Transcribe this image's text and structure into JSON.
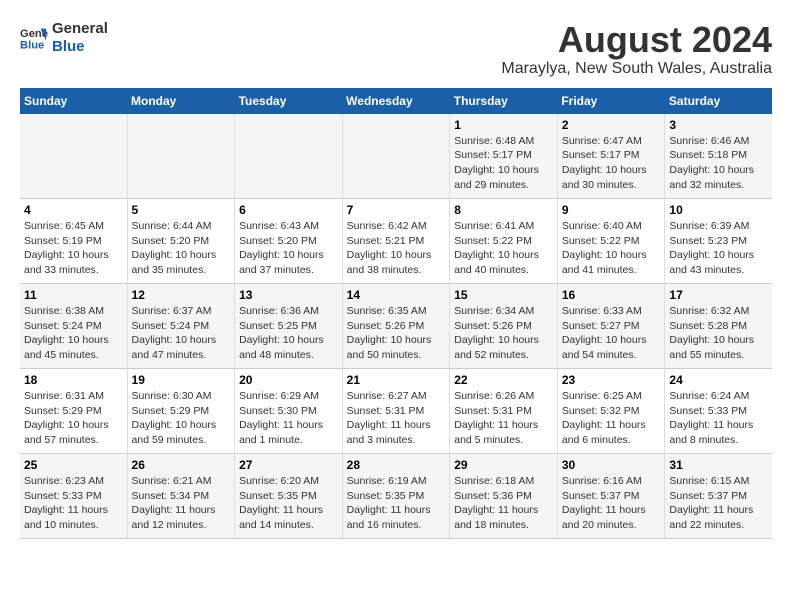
{
  "header": {
    "logo_line1": "General",
    "logo_line2": "Blue",
    "title": "August 2024",
    "subtitle": "Maraylya, New South Wales, Australia"
  },
  "days_of_week": [
    "Sunday",
    "Monday",
    "Tuesday",
    "Wednesday",
    "Thursday",
    "Friday",
    "Saturday"
  ],
  "weeks": [
    {
      "cells": [
        {
          "day": "",
          "info": ""
        },
        {
          "day": "",
          "info": ""
        },
        {
          "day": "",
          "info": ""
        },
        {
          "day": "",
          "info": ""
        },
        {
          "day": "1",
          "info": "Sunrise: 6:48 AM\nSunset: 5:17 PM\nDaylight: 10 hours\nand 29 minutes."
        },
        {
          "day": "2",
          "info": "Sunrise: 6:47 AM\nSunset: 5:17 PM\nDaylight: 10 hours\nand 30 minutes."
        },
        {
          "day": "3",
          "info": "Sunrise: 6:46 AM\nSunset: 5:18 PM\nDaylight: 10 hours\nand 32 minutes."
        }
      ]
    },
    {
      "cells": [
        {
          "day": "4",
          "info": "Sunrise: 6:45 AM\nSunset: 5:19 PM\nDaylight: 10 hours\nand 33 minutes."
        },
        {
          "day": "5",
          "info": "Sunrise: 6:44 AM\nSunset: 5:20 PM\nDaylight: 10 hours\nand 35 minutes."
        },
        {
          "day": "6",
          "info": "Sunrise: 6:43 AM\nSunset: 5:20 PM\nDaylight: 10 hours\nand 37 minutes."
        },
        {
          "day": "7",
          "info": "Sunrise: 6:42 AM\nSunset: 5:21 PM\nDaylight: 10 hours\nand 38 minutes."
        },
        {
          "day": "8",
          "info": "Sunrise: 6:41 AM\nSunset: 5:22 PM\nDaylight: 10 hours\nand 40 minutes."
        },
        {
          "day": "9",
          "info": "Sunrise: 6:40 AM\nSunset: 5:22 PM\nDaylight: 10 hours\nand 41 minutes."
        },
        {
          "day": "10",
          "info": "Sunrise: 6:39 AM\nSunset: 5:23 PM\nDaylight: 10 hours\nand 43 minutes."
        }
      ]
    },
    {
      "cells": [
        {
          "day": "11",
          "info": "Sunrise: 6:38 AM\nSunset: 5:24 PM\nDaylight: 10 hours\nand 45 minutes."
        },
        {
          "day": "12",
          "info": "Sunrise: 6:37 AM\nSunset: 5:24 PM\nDaylight: 10 hours\nand 47 minutes."
        },
        {
          "day": "13",
          "info": "Sunrise: 6:36 AM\nSunset: 5:25 PM\nDaylight: 10 hours\nand 48 minutes."
        },
        {
          "day": "14",
          "info": "Sunrise: 6:35 AM\nSunset: 5:26 PM\nDaylight: 10 hours\nand 50 minutes."
        },
        {
          "day": "15",
          "info": "Sunrise: 6:34 AM\nSunset: 5:26 PM\nDaylight: 10 hours\nand 52 minutes."
        },
        {
          "day": "16",
          "info": "Sunrise: 6:33 AM\nSunset: 5:27 PM\nDaylight: 10 hours\nand 54 minutes."
        },
        {
          "day": "17",
          "info": "Sunrise: 6:32 AM\nSunset: 5:28 PM\nDaylight: 10 hours\nand 55 minutes."
        }
      ]
    },
    {
      "cells": [
        {
          "day": "18",
          "info": "Sunrise: 6:31 AM\nSunset: 5:29 PM\nDaylight: 10 hours\nand 57 minutes."
        },
        {
          "day": "19",
          "info": "Sunrise: 6:30 AM\nSunset: 5:29 PM\nDaylight: 10 hours\nand 59 minutes."
        },
        {
          "day": "20",
          "info": "Sunrise: 6:29 AM\nSunset: 5:30 PM\nDaylight: 11 hours\nand 1 minute."
        },
        {
          "day": "21",
          "info": "Sunrise: 6:27 AM\nSunset: 5:31 PM\nDaylight: 11 hours\nand 3 minutes."
        },
        {
          "day": "22",
          "info": "Sunrise: 6:26 AM\nSunset: 5:31 PM\nDaylight: 11 hours\nand 5 minutes."
        },
        {
          "day": "23",
          "info": "Sunrise: 6:25 AM\nSunset: 5:32 PM\nDaylight: 11 hours\nand 6 minutes."
        },
        {
          "day": "24",
          "info": "Sunrise: 6:24 AM\nSunset: 5:33 PM\nDaylight: 11 hours\nand 8 minutes."
        }
      ]
    },
    {
      "cells": [
        {
          "day": "25",
          "info": "Sunrise: 6:23 AM\nSunset: 5:33 PM\nDaylight: 11 hours\nand 10 minutes."
        },
        {
          "day": "26",
          "info": "Sunrise: 6:21 AM\nSunset: 5:34 PM\nDaylight: 11 hours\nand 12 minutes."
        },
        {
          "day": "27",
          "info": "Sunrise: 6:20 AM\nSunset: 5:35 PM\nDaylight: 11 hours\nand 14 minutes."
        },
        {
          "day": "28",
          "info": "Sunrise: 6:19 AM\nSunset: 5:35 PM\nDaylight: 11 hours\nand 16 minutes."
        },
        {
          "day": "29",
          "info": "Sunrise: 6:18 AM\nSunset: 5:36 PM\nDaylight: 11 hours\nand 18 minutes."
        },
        {
          "day": "30",
          "info": "Sunrise: 6:16 AM\nSunset: 5:37 PM\nDaylight: 11 hours\nand 20 minutes."
        },
        {
          "day": "31",
          "info": "Sunrise: 6:15 AM\nSunset: 5:37 PM\nDaylight: 11 hours\nand 22 minutes."
        }
      ]
    }
  ]
}
